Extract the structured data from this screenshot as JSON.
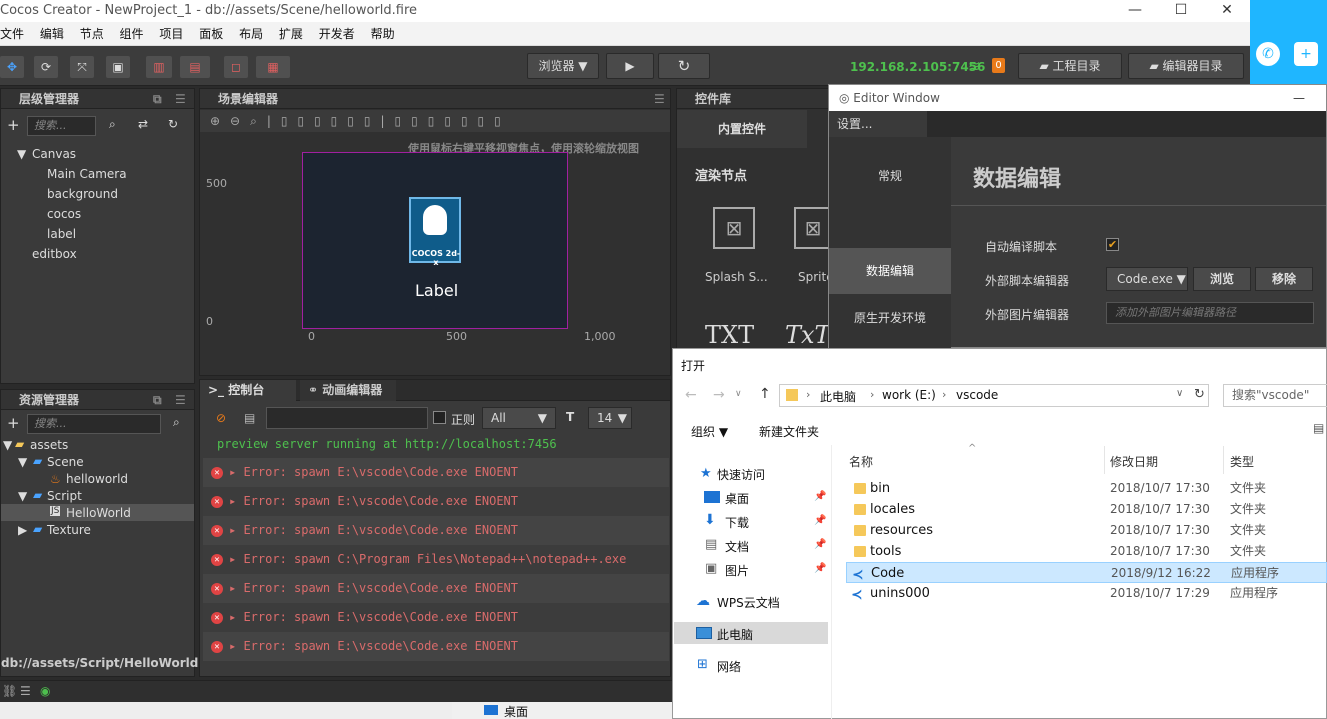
{
  "window": {
    "title": "Cocos Creator - NewProject_1 - db://assets/Scene/helloworld.fire",
    "minimize": "—",
    "maximize": "☐",
    "close": "✕"
  },
  "menu": [
    "文件",
    "编辑",
    "节点",
    "组件",
    "项目",
    "面板",
    "布局",
    "扩展",
    "开发者",
    "帮助"
  ],
  "toolbar": {
    "browser": "浏览器 ▼",
    "play": "▶",
    "refresh": "↻",
    "ip": "192.168.2.105:7456",
    "badge": "0",
    "project_dir": "工程目录",
    "editor_dir": "编辑器目录"
  },
  "hierarchy": {
    "title": "层级管理器",
    "search_placeholder": "搜索...",
    "items": [
      "Canvas",
      "Main Camera",
      "background",
      "cocos",
      "label",
      "editbox"
    ]
  },
  "scene": {
    "title": "场景编辑器",
    "hint": "使用鼠标右键平移视窗焦点，使用滚轮缩放视图",
    "y500": "500",
    "y0": "0",
    "x0": "0",
    "x500": "500",
    "x1000": "1,000",
    "label": "Label",
    "logo_text": "COCOS 2d-x"
  },
  "assets": {
    "title": "资源管理器",
    "search_placeholder": "搜索...",
    "items": [
      "assets",
      "Scene",
      "helloworld",
      "Script",
      "HelloWorld",
      "Texture"
    ],
    "path": "db://assets/Script/HelloWorld.js"
  },
  "console": {
    "tab1": "控制台",
    "tab2": "动画编辑器",
    "regex": "正则",
    "level": "All",
    "fontsize": "14",
    "lines": [
      "preview server running at http://localhost:7456",
      "Error: spawn E:\\vscode\\Code.exe ENOENT",
      "Error: spawn E:\\vscode\\Code.exe ENOENT",
      "Error: spawn E:\\vscode\\Code.exe ENOENT",
      "Error: spawn C:\\Program Files\\Notepad++\\notepad++.exe",
      "Error: spawn E:\\vscode\\Code.exe ENOENT",
      "Error: spawn E:\\vscode\\Code.exe ENOENT",
      "Error: spawn E:\\vscode\\Code.exe ENOENT"
    ]
  },
  "widgets": {
    "title": "控件库",
    "tab": "内置控件",
    "section": "渲染节点",
    "item1": "Splash S...",
    "item2": "Sprite",
    "txt1": "TXT",
    "txt2": "TxT"
  },
  "editor_window": {
    "title": "Editor Window",
    "settings": "设置...",
    "nav": [
      "常规",
      "数据编辑",
      "原生开发环境"
    ],
    "heading": "数据编辑",
    "auto_compile": "自动编译脚本",
    "ext_script_editor": "外部脚本编辑器",
    "code_select": "Code.exe ▼",
    "browse": "浏览",
    "remove": "移除",
    "ext_image_editor": "外部图片编辑器",
    "image_placeholder": "添加外部图片编辑器路径"
  },
  "open_dialog": {
    "title": "打开",
    "crumbs": [
      "此电脑",
      "work (E:)",
      "vscode"
    ],
    "search_placeholder": "搜索\"vscode\"",
    "organize": "组织 ▼",
    "new_folder": "新建文件夹",
    "columns": [
      "名称",
      "修改日期",
      "类型"
    ],
    "nav": [
      "快速访问",
      "桌面",
      "下载",
      "文档",
      "图片",
      "WPS云文档",
      "此电脑",
      "网络"
    ],
    "files": [
      {
        "name": "bin",
        "date": "2018/10/7 17:30",
        "type": "文件夹",
        "icon": "folder"
      },
      {
        "name": "locales",
        "date": "2018/10/7 17:30",
        "type": "文件夹",
        "icon": "folder"
      },
      {
        "name": "resources",
        "date": "2018/10/7 17:30",
        "type": "文件夹",
        "icon": "folder"
      },
      {
        "name": "tools",
        "date": "2018/10/7 17:30",
        "type": "文件夹",
        "icon": "folder"
      },
      {
        "name": "Code",
        "date": "2018/9/12 16:22",
        "type": "应用程序",
        "icon": "vscode"
      },
      {
        "name": "unins000",
        "date": "2018/10/7 17:29",
        "type": "应用程序",
        "icon": "vscode"
      }
    ]
  },
  "taskbar": {
    "desktop": "桌面"
  }
}
